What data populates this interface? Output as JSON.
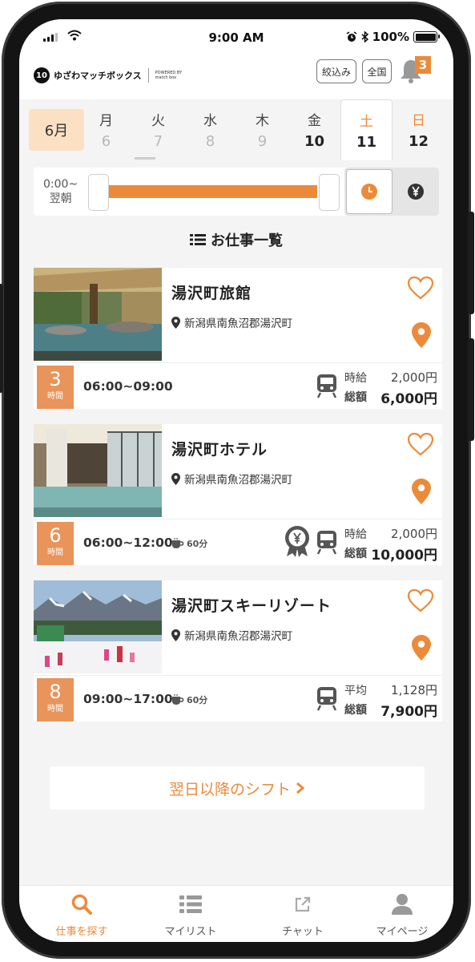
{
  "status_bar": {
    "time": "9:00 AM",
    "battery": "100%"
  },
  "header": {
    "logo_mark": "10",
    "logo_text": "ゆざわマッチボックス",
    "logo_powered": "POWERED BY match box",
    "filter_button": "絞込み",
    "region_button": "全国",
    "notification_count": "3"
  },
  "dates": {
    "month": "6月",
    "days": [
      {
        "weekday": "月",
        "day": "6"
      },
      {
        "weekday": "火",
        "day": "7"
      },
      {
        "weekday": "水",
        "day": "8"
      },
      {
        "weekday": "木",
        "day": "9"
      },
      {
        "weekday": "金",
        "day": "10"
      },
      {
        "weekday": "土",
        "day": "11"
      },
      {
        "weekday": "日",
        "day": "12"
      }
    ]
  },
  "time_filter": {
    "label_line1": "0:00~",
    "label_line2": "翌朝"
  },
  "section_title": "お仕事一覧",
  "jobs": [
    {
      "title": "湯沢町旅館",
      "address": "新潟県南魚沼郡湯沢町",
      "hours": "3",
      "hours_unit": "時間",
      "time": "06:00~09:00",
      "break": "",
      "rate_label": "時給",
      "rate_value": "2,000円",
      "total_label": "総額",
      "total_value": "6,000円"
    },
    {
      "title": "湯沢町ホテル",
      "address": "新潟県南魚沼郡湯沢町",
      "hours": "6",
      "hours_unit": "時間",
      "time": "06:00~12:00",
      "break": "60分",
      "rate_label": "時給",
      "rate_value": "2,000円",
      "total_label": "総額",
      "total_value": "10,000円"
    },
    {
      "title": "湯沢町スキーリゾート",
      "address": "新潟県南魚沼郡湯沢町",
      "hours": "8",
      "hours_unit": "時間",
      "time": "09:00~17:00",
      "break": "60分",
      "rate_label": "平均",
      "rate_value": "1,128円",
      "total_label": "総額",
      "total_value": "7,900円"
    }
  ],
  "next_shifts_button": "翌日以降のシフト",
  "tabs": [
    {
      "label": "仕事を探す",
      "icon": "search-icon"
    },
    {
      "label": "マイリスト",
      "icon": "list-icon"
    },
    {
      "label": "チャット",
      "icon": "external-link-icon"
    },
    {
      "label": "マイページ",
      "icon": "user-icon"
    }
  ],
  "colors": {
    "accent": "#ed8a3a",
    "month_bg": "#fce0c4",
    "hours_box": "#e9945a"
  }
}
